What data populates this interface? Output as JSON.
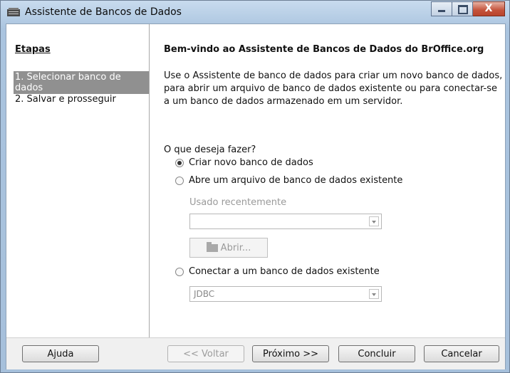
{
  "window": {
    "title": "Assistente de Bancos de Dados",
    "close_glyph": "X"
  },
  "sidebar": {
    "title": "Etapas",
    "steps": [
      {
        "label": "1. Selecionar banco de dados"
      },
      {
        "label": "2. Salvar e prosseguir"
      }
    ]
  },
  "main": {
    "heading": "Bem-vindo ao Assistente de Bancos de Dados do BrOffice.org",
    "intro": "Use o Assistente de banco de dados para criar um novo banco de dados, para abrir um arquivo de banco de dados existente ou para conectar-se a um banco de dados armazenado em um servidor.",
    "question": "O que deseja fazer?",
    "options": [
      {
        "label": "Criar novo banco de dados",
        "selected": true
      },
      {
        "label": "Abre um arquivo de banco de dados existente",
        "selected": false
      },
      {
        "label": "Conectar a um banco de dados existente",
        "selected": false
      }
    ],
    "recent_label": "Usado recentemente",
    "recent_value": "",
    "open_button": "Abrir...",
    "connection_type": "JDBC"
  },
  "buttons": {
    "help": "Ajuda",
    "back": "<< Voltar",
    "next": "Próximo >>",
    "finish": "Concluir",
    "cancel": "Cancelar"
  },
  "colors": {
    "active_step_bg": "#909090",
    "title_bar": "#aac4df"
  }
}
